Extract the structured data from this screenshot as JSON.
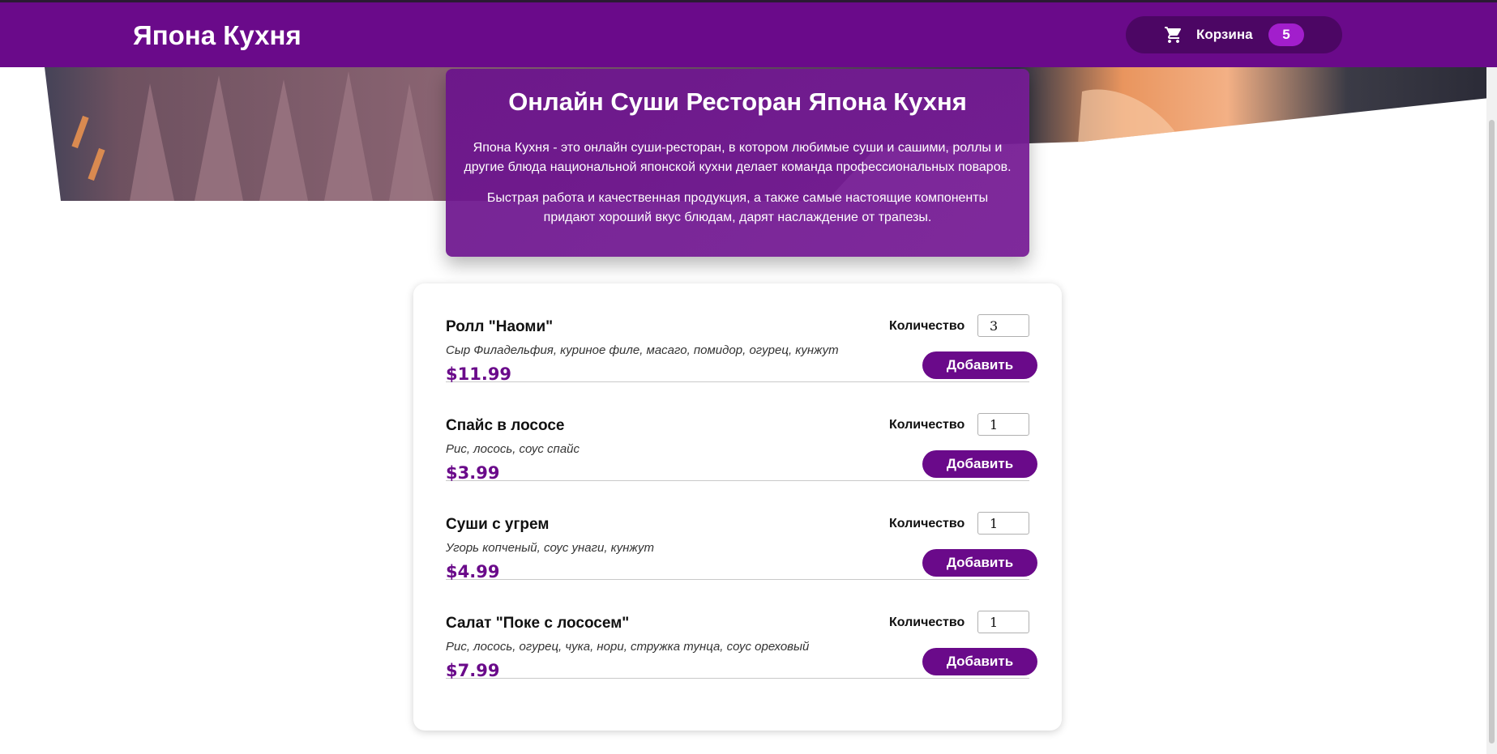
{
  "header": {
    "brand": "Япона Кухня",
    "cart": {
      "label": "Корзина",
      "count": "5"
    }
  },
  "intro": {
    "title": "Онлайн Суши Ресторан Япона Кухня",
    "paragraph1": "Япона Кухня - это онлайн суши-ресторан, в котором любимые суши и сашими, роллы и другие блюда национальной японской кухни делает команда профессиональных поваров.",
    "paragraph2": "Быстрая работа и качественная продукция, а также самые настоящие компоненты придают хороший вкус блюдам, дарят наслаждение от трапезы."
  },
  "menu": {
    "items": [
      {
        "name": "Ролл \"Наоми\"",
        "description": "Сыр Филадельфия, куриное филе, масаго, помидор, огурец, кунжут",
        "price": "$11.99",
        "qty_label": "Количество",
        "qty": "3",
        "button": "Добавить"
      },
      {
        "name": "Спайс в лососе",
        "description": "Рис, лосось, соус спайс",
        "price": "$3.99",
        "qty_label": "Количество",
        "qty": "1",
        "button": "Добавить"
      },
      {
        "name": "Суши с угрем",
        "description": "Угорь копченый, соус унаги, кунжут",
        "price": "$4.99",
        "qty_label": "Количество",
        "qty": "1",
        "button": "Добавить"
      },
      {
        "name": "Салат \"Поке с лососем\"",
        "description": "Рис, лосось, огурец, чука, нори, стружка тунца, соус ореховый",
        "price": "$7.99",
        "qty_label": "Количество",
        "qty": "1",
        "button": "Добавить"
      }
    ]
  },
  "colors": {
    "brand": "#6a0a8a",
    "cart_pill": "#4c0664",
    "badge": "#a21ecc",
    "price": "#6a0a8a"
  },
  "icons": {
    "cart": "shopping-cart-icon"
  }
}
